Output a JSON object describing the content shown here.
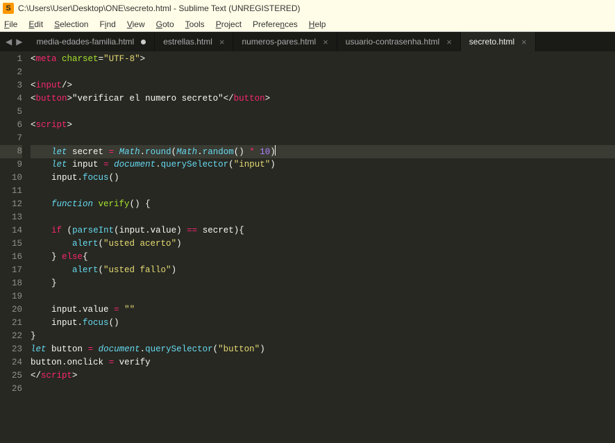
{
  "window": {
    "title": "C:\\Users\\User\\Desktop\\ONE\\secreto.html - Sublime Text (UNREGISTERED)"
  },
  "menu": {
    "file": "File",
    "edit": "Edit",
    "selection": "Selection",
    "find": "Find",
    "view": "View",
    "goto": "Goto",
    "tools": "Tools",
    "project": "Project",
    "preferences": "Preferences",
    "help": "Help"
  },
  "tabs": [
    {
      "label": "media-edades-familia.html",
      "dirty": true,
      "active": false
    },
    {
      "label": "estrellas.html",
      "dirty": false,
      "active": false
    },
    {
      "label": "numeros-pares.html",
      "dirty": false,
      "active": false
    },
    {
      "label": "usuario-contrasenha.html",
      "dirty": false,
      "active": false
    },
    {
      "label": "secreto.html",
      "dirty": false,
      "active": true
    }
  ],
  "nav": {
    "left": "◀",
    "right": "▶"
  },
  "code": {
    "lines": [
      {
        "n": 1,
        "raw": "<meta charset=\"UTF-8\">"
      },
      {
        "n": 2,
        "raw": ""
      },
      {
        "n": 3,
        "raw": "<input/>"
      },
      {
        "n": 4,
        "raw": "<button>\"verificar el numero secreto\"</button>"
      },
      {
        "n": 5,
        "raw": ""
      },
      {
        "n": 6,
        "raw": "<script>"
      },
      {
        "n": 7,
        "raw": ""
      },
      {
        "n": 8,
        "raw": "    let secret = Math.round(Math.random() * 10)",
        "current": true
      },
      {
        "n": 9,
        "raw": "    let input = document.querySelector(\"input\")"
      },
      {
        "n": 10,
        "raw": "    input.focus()"
      },
      {
        "n": 11,
        "raw": ""
      },
      {
        "n": 12,
        "raw": "    function verify() {"
      },
      {
        "n": 13,
        "raw": ""
      },
      {
        "n": 14,
        "raw": "    if (parseInt(input.value) == secret){"
      },
      {
        "n": 15,
        "raw": "        alert(\"usted acerto\")"
      },
      {
        "n": 16,
        "raw": "    } else{"
      },
      {
        "n": 17,
        "raw": "        alert(\"usted fallo\")"
      },
      {
        "n": 18,
        "raw": "    }"
      },
      {
        "n": 19,
        "raw": ""
      },
      {
        "n": 20,
        "raw": "    input.value = \"\""
      },
      {
        "n": 21,
        "raw": "    input.focus()"
      },
      {
        "n": 22,
        "raw": "}"
      },
      {
        "n": 23,
        "raw": "let button = document.querySelector(\"button\")"
      },
      {
        "n": 24,
        "raw": "button.onclick = verify"
      },
      {
        "n": 25,
        "raw": "</script>"
      },
      {
        "n": 26,
        "raw": ""
      }
    ]
  }
}
